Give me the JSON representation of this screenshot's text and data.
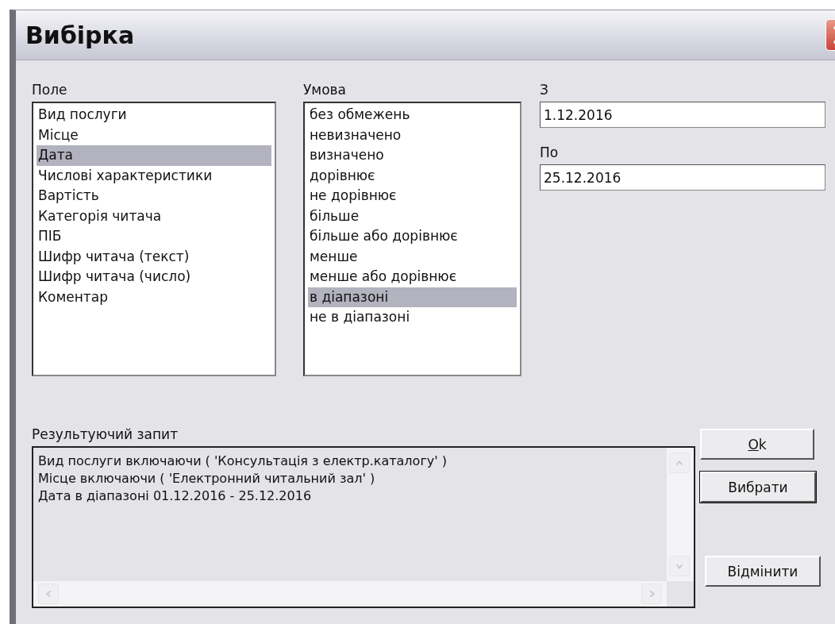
{
  "window": {
    "title": "Вибірка"
  },
  "field_list": {
    "label": "Поле",
    "items": [
      {
        "text": "Вид послуги",
        "selected": false
      },
      {
        "text": "Місце",
        "selected": false
      },
      {
        "text": "Дата",
        "selected": true
      },
      {
        "text": "Числові характеристики",
        "selected": false
      },
      {
        "text": "Вартість",
        "selected": false
      },
      {
        "text": "Категорія читача",
        "selected": false
      },
      {
        "text": "ПІБ",
        "selected": false
      },
      {
        "text": "Шифр читача (текст)",
        "selected": false
      },
      {
        "text": "Шифр читача (число)",
        "selected": false
      },
      {
        "text": "Коментар",
        "selected": false
      }
    ]
  },
  "condition_list": {
    "label": "Умова",
    "items": [
      {
        "text": "без обмежень",
        "selected": false
      },
      {
        "text": "невизначено",
        "selected": false
      },
      {
        "text": "визначено",
        "selected": false
      },
      {
        "text": "дорівнює",
        "selected": false
      },
      {
        "text": "не дорівнює",
        "selected": false
      },
      {
        "text": "більше",
        "selected": false
      },
      {
        "text": "більше або дорівнює",
        "selected": false
      },
      {
        "text": "менше",
        "selected": false
      },
      {
        "text": "менше або дорівнює",
        "selected": false
      },
      {
        "text": "в діапазоні",
        "selected": true
      },
      {
        "text": "не в діапазоні",
        "selected": false
      }
    ]
  },
  "from": {
    "label": "З",
    "value": "1.12.2016"
  },
  "to": {
    "label": "По",
    "value": "25.12.2016"
  },
  "result_query": {
    "label": "Результуючий запит",
    "lines": [
      "Вид послуги включаючи ( 'Консультація з електр.каталогу' )",
      "Місце включаючи ( 'Електронний читальний зал' )",
      "Дата в діапазоні 01.12.2016 - 25.12.2016"
    ]
  },
  "buttons": {
    "ok": "Ok",
    "select": "Вибрати",
    "cancel": "Відмінити"
  }
}
